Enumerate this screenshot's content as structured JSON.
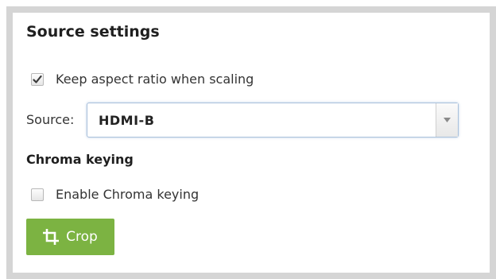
{
  "panel": {
    "title": "Source settings"
  },
  "keep_aspect": {
    "label": "Keep aspect ratio when scaling",
    "checked": true
  },
  "source": {
    "label": "Source:",
    "selected": "HDMI-B"
  },
  "chroma": {
    "heading": "Chroma keying",
    "enable_label": "Enable Chroma keying",
    "enabled": false
  },
  "crop_button": {
    "label": "Crop",
    "icon": "crop-icon",
    "color": "#7cb342"
  }
}
